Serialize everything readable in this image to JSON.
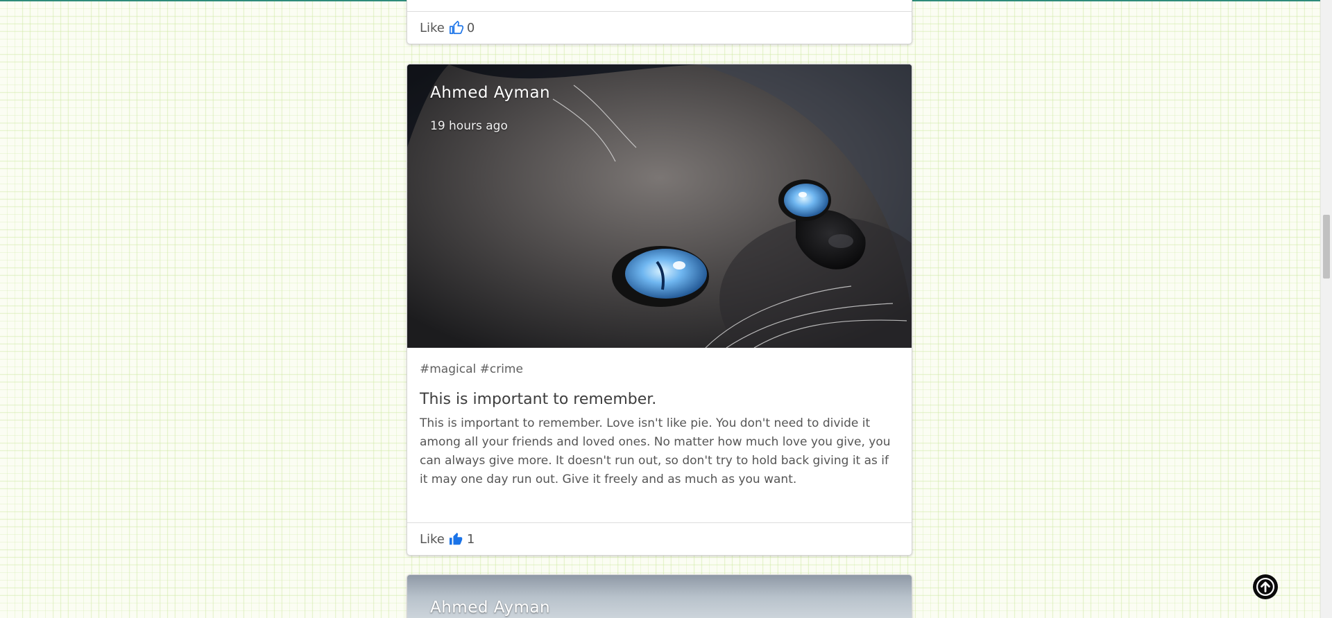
{
  "previous_post": {
    "like_label": "Like",
    "like_count": "0"
  },
  "post": {
    "author": "Ahmed Ayman",
    "time_ago": "19 hours ago",
    "tags": "#magical #crime",
    "title": "This is important to remember.",
    "body": "This is important to remember. Love isn't like pie. You don't need to divide it among all your friends and loved ones. No matter how much love you give, you can always give more. It doesn't run out, so don't try to hold back giving it as if it may one day run out. Give it freely and as much as you want.",
    "like_label": "Like",
    "like_count": "1",
    "liked": true,
    "image_subject": "cat-closeup"
  },
  "next_post": {
    "author": "Ahmed Ayman"
  },
  "colors": {
    "like_blue": "#1a73e8",
    "scroll_top_bg": "#0b0b0b"
  }
}
